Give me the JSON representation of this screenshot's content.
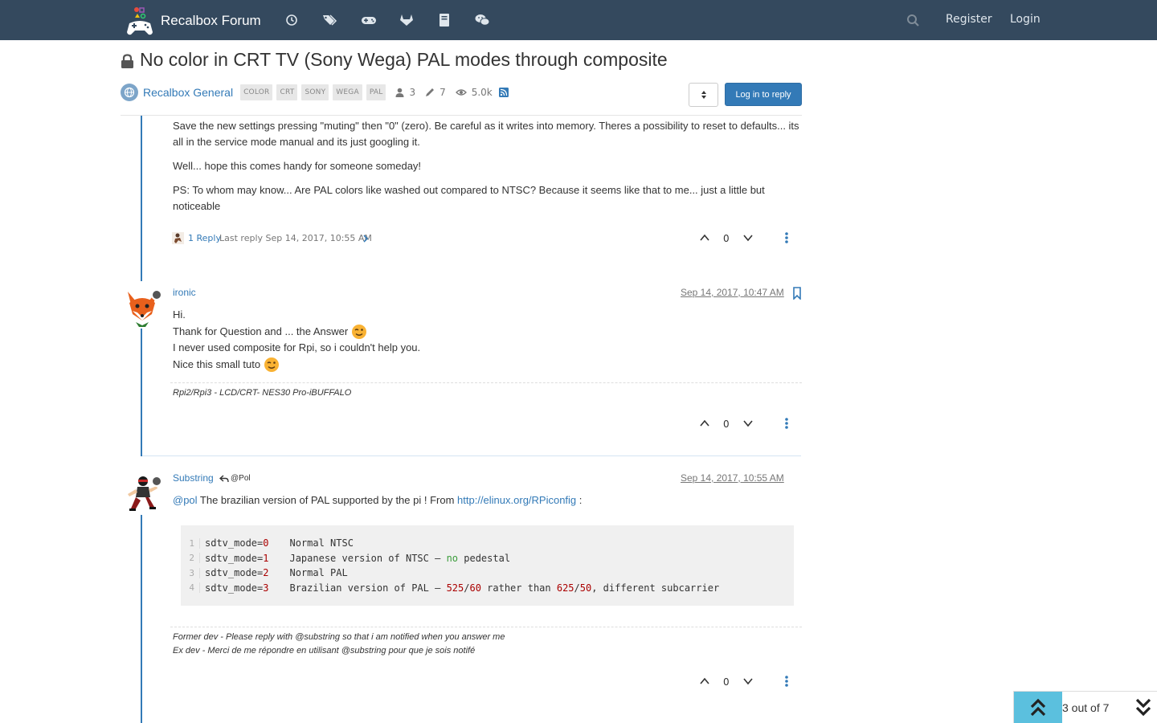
{
  "navbar": {
    "brand": "Recalbox Forum",
    "icons": [
      "clock-icon",
      "tags-icon",
      "gamepad-icon",
      "gitlab-icon",
      "book-icon",
      "wechat-icon"
    ],
    "search_icon": "search-icon",
    "register": "Register",
    "login": "Login",
    "bg_color": "#34495e"
  },
  "topic": {
    "title": "No color in CRT TV (Sony Wega) PAL modes through composite",
    "category": "Recalbox General",
    "tags": [
      "COLOR",
      "CRT",
      "SONY",
      "WEGA",
      "PAL"
    ],
    "posters": "3",
    "posts": "7",
    "views": "5.0k",
    "reply_button": "Log in to reply"
  },
  "post1": {
    "para1": "Save the new settings pressing \"muting\" then \"0\" (zero). Be careful as it writes into memory. Theres a possibility to reset to defaults... its all in the service mode manual and its just googling it.",
    "para2": "Well... hope this comes handy for someone someday!",
    "para3": "PS: To whom may know... Are PAL colors like washed out compared to NTSC? Because it seems like that to me... just a little but noticeable",
    "replies_link": "1 Reply",
    "last_reply": "Last reply Sep 14, 2017, 10:55 AM",
    "votes": "0"
  },
  "post2": {
    "username": "ironic",
    "timestamp": "Sep 14, 2017, 10:47 AM",
    "line1": "Hi.",
    "line2": "Thank for Question and ... the Answer",
    "line3": "I never used composite for Rpi, so i couldn't help you.",
    "line4": "Nice this small tuto",
    "signature": "Rpi2/Rpi3 - LCD/CRT- NES30 Pro-iBUFFALO",
    "votes": "0"
  },
  "post3": {
    "username": "Substring",
    "reply_to": "@Pol",
    "timestamp": "Sep 14, 2017, 10:55 AM",
    "mention": "@pol",
    "text_mid": " The brazilian version of PAL supported by the pi ! From ",
    "link": "http://elinux.org/RPiconfig",
    "text_end": " :",
    "code": [
      {
        "ln": "1",
        "key": "sdtv_mode=",
        "val": "0",
        "desc": "Normal NTSC"
      },
      {
        "ln": "2",
        "key": "sdtv_mode=",
        "val": "1",
        "desc": "Japanese version of NTSC – no pedestal"
      },
      {
        "ln": "3",
        "key": "sdtv_mode=",
        "val": "2",
        "desc": "Normal PAL"
      },
      {
        "ln": "4",
        "key": "sdtv_mode=",
        "val": "3",
        "desc": "Brazilian version of PAL – 525/60 rather than 625/50, different subcarrier"
      }
    ],
    "sig1": "Former dev - Please reply with @substring so that i am notified when you answer me",
    "sig2": "Ex dev - Merci de me répondre en utilisant @substring pour que je sois notifé",
    "votes": "0"
  },
  "pager": {
    "text": "3 out of 7"
  }
}
